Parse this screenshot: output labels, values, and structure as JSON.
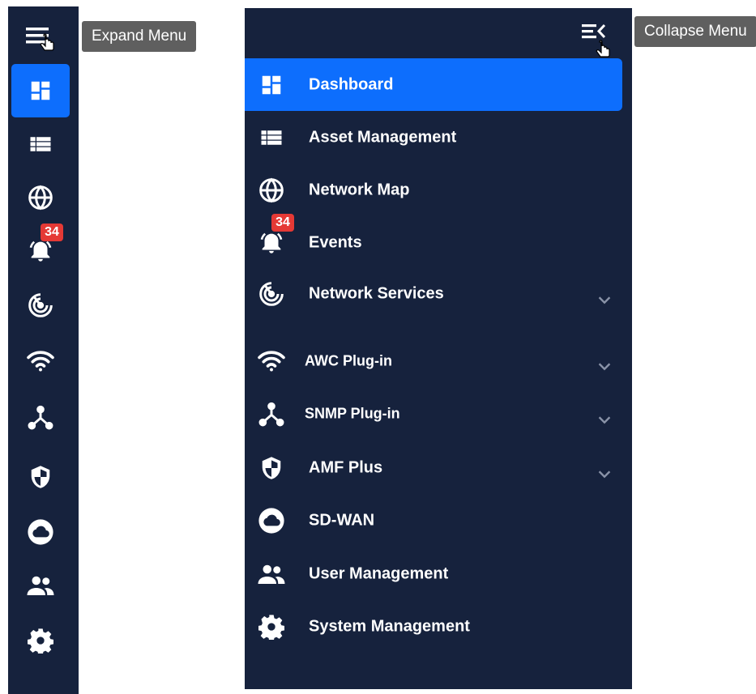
{
  "tooltips": {
    "expand": "Expand Menu",
    "collapse": "Collapse Menu"
  },
  "events_badge": "34",
  "menu": [
    {
      "key": "dashboard",
      "label": "Dashboard",
      "icon": "dashboard-icon",
      "active": true,
      "expandable": false
    },
    {
      "key": "asset-management",
      "label": "Asset Management",
      "icon": "list-icon",
      "expandable": false
    },
    {
      "key": "network-map",
      "label": "Network Map",
      "icon": "globe-icon",
      "expandable": false
    },
    {
      "key": "events",
      "label": "Events",
      "icon": "alarm-bell-icon",
      "expandable": false
    },
    {
      "key": "network-services",
      "label": "Network Services",
      "icon": "radar-icon",
      "expandable": true
    },
    {
      "key": "awc-plug-in",
      "label": "AWC Plug-in",
      "icon": "wifi-icon",
      "expandable": true
    },
    {
      "key": "snmp-plug-in",
      "label": "SNMP Plug-in",
      "icon": "network-topology-icon",
      "expandable": true
    },
    {
      "key": "amf-plus",
      "label": "AMF Plus",
      "icon": "shield-icon",
      "expandable": true
    },
    {
      "key": "sd-wan",
      "label": "SD-WAN",
      "icon": "cloud-icon",
      "expandable": false
    },
    {
      "key": "user-management",
      "label": "User Management",
      "icon": "users-icon",
      "expandable": false
    },
    {
      "key": "system-management",
      "label": "System Management",
      "icon": "gear-icon",
      "expandable": false
    }
  ],
  "colors": {
    "sidebar_bg": "#16223d",
    "active_bg": "#0d6efd",
    "badge_bg": "#e53935",
    "tooltip_bg": "#5f5f5f",
    "text": "#ffffff",
    "chevron": "#8a93a8"
  }
}
